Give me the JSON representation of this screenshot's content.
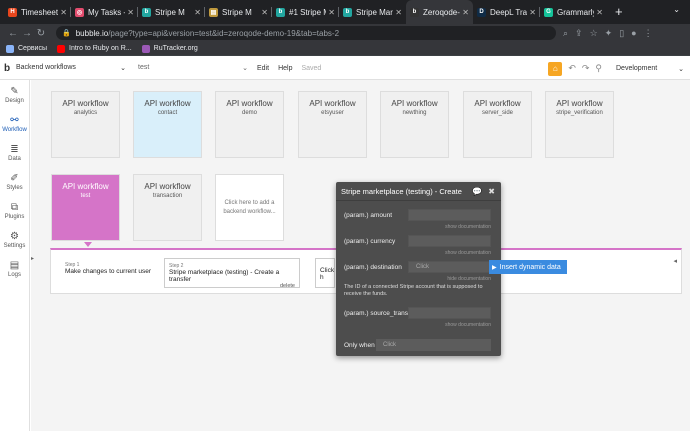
{
  "browser": {
    "tabs": [
      {
        "title": "Timesheet",
        "color": "#e8461d",
        "glyph": "H",
        "active": false
      },
      {
        "title": "My Tasks -",
        "color": "#e34c6e",
        "glyph": "◎",
        "active": false
      },
      {
        "title": "Stripe M",
        "color": "#22a6a0",
        "glyph": "b",
        "active": false
      },
      {
        "title": "Stripe M",
        "color": "#c09a3e",
        "glyph": "▤",
        "active": false
      },
      {
        "title": "#1 Stripe M",
        "color": "#22a6a0",
        "glyph": "b",
        "active": false
      },
      {
        "title": "Stripe Mark",
        "color": "#22a6a0",
        "glyph": "b",
        "active": false
      },
      {
        "title": "Zeroqode-",
        "color": "#333",
        "glyph": "b",
        "active": true
      },
      {
        "title": "DeepL Tra",
        "color": "#0f2b46",
        "glyph": "D",
        "active": false
      },
      {
        "title": "Grammarly",
        "color": "#15c39a",
        "glyph": "G",
        "active": false
      }
    ],
    "new_tab": "+",
    "url_host": "bubble.io",
    "url_path": "/page?type=api&version=test&id=zeroqode-demo-19&tab=tabs-2",
    "bookmarks": [
      {
        "label": "Сервисы",
        "color": "#8ab4f8"
      },
      {
        "label": "Intro to Ruby on R...",
        "color": "#ff0000"
      },
      {
        "label": "RuTracker.org",
        "color": "#9b59b6"
      }
    ]
  },
  "app": {
    "logo": "b",
    "page_selector": "Backend workflows",
    "version_selector": "test",
    "menu": [
      "Edit",
      "Help"
    ],
    "saved": "Saved",
    "environment": "Development"
  },
  "sidebar": [
    {
      "label": "Design",
      "icon": "design-icon",
      "glyph": "✎"
    },
    {
      "label": "Workflow",
      "icon": "workflow-icon",
      "glyph": "⚯"
    },
    {
      "label": "Data",
      "icon": "data-icon",
      "glyph": "≣"
    },
    {
      "label": "Styles",
      "icon": "styles-icon",
      "glyph": "✐"
    },
    {
      "label": "Plugins",
      "icon": "plugins-icon",
      "glyph": "⧉"
    },
    {
      "label": "Settings",
      "icon": "settings-icon",
      "glyph": "⚙"
    },
    {
      "label": "Logs",
      "icon": "logs-icon",
      "glyph": "▤"
    }
  ],
  "workflows": [
    {
      "title": "API workflow",
      "sub": "analytics"
    },
    {
      "title": "API workflow",
      "sub": "contact"
    },
    {
      "title": "API workflow",
      "sub": "demo"
    },
    {
      "title": "API workflow",
      "sub": "etsyuser"
    },
    {
      "title": "API workflow",
      "sub": "newthing"
    },
    {
      "title": "API workflow",
      "sub": "server_side"
    },
    {
      "title": "API workflow",
      "sub": "stripe_verification"
    },
    {
      "title": "API workflow",
      "sub": "test"
    },
    {
      "title": "API workflow",
      "sub": "transaction"
    }
  ],
  "add_workflow": "Click here to add a backend workflow...",
  "steps": {
    "step1": {
      "num": "Step 1",
      "desc": "Make changes to current user"
    },
    "step2": {
      "num": "Step 2",
      "desc": "Stripe marketplace (testing) - Create a transfer",
      "sub": "delete"
    },
    "step3": {
      "desc": "Click h"
    }
  },
  "panel": {
    "title": "Stripe marketplace (testing) - Create",
    "fields": [
      {
        "label": "(param.) amount",
        "doc": "show documentation"
      },
      {
        "label": "(param.) currency",
        "doc": "show documentation"
      },
      {
        "label": "(param.) destination",
        "value": "Click",
        "doc": "hide documentation"
      },
      {
        "label": "(param.) source_trans",
        "doc": "show documentation"
      }
    ],
    "description": "The ID of a connected Stripe account that is supposed to receive the funds.",
    "only_when_label": "Only when",
    "only_when_value": "Click"
  },
  "insert_dynamic": "Insert dynamic data"
}
